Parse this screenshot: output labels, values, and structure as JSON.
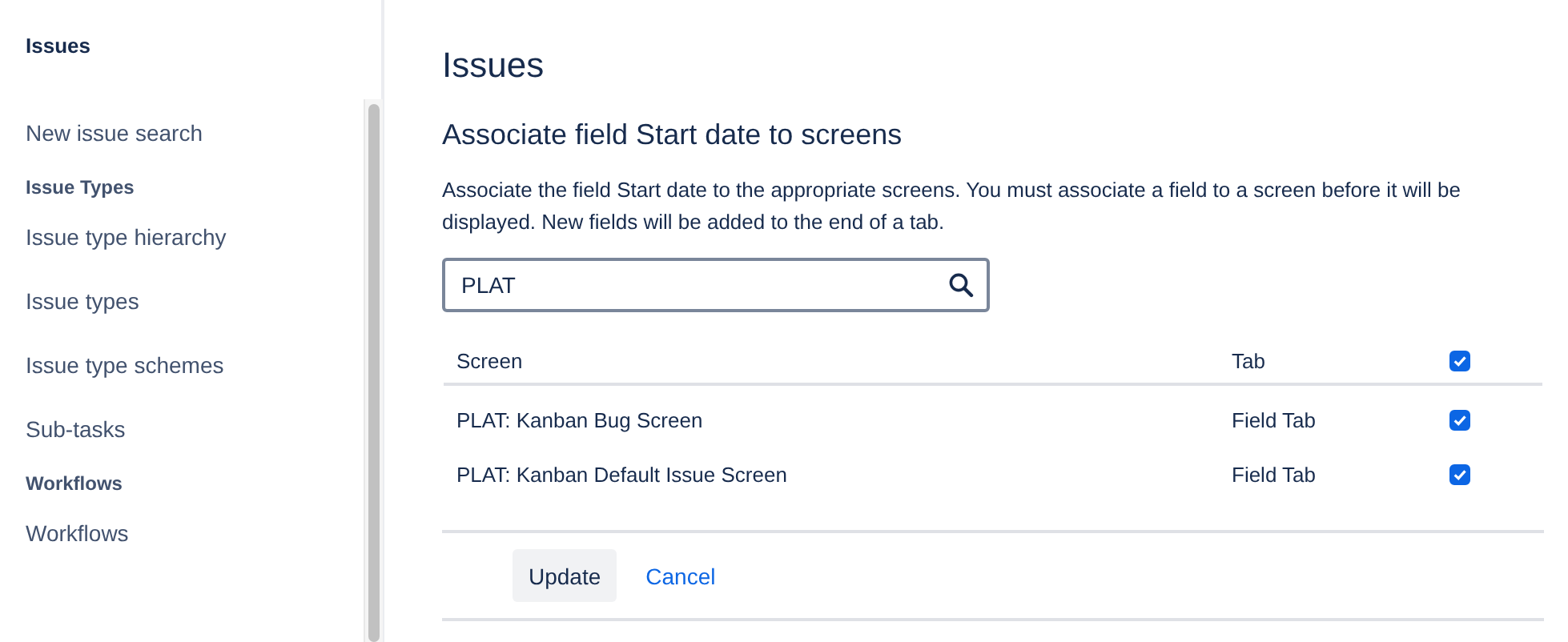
{
  "sidebar": {
    "title": "Issues",
    "items": [
      {
        "kind": "link",
        "label": "New issue search"
      },
      {
        "kind": "heading",
        "label": "Issue Types"
      },
      {
        "kind": "link",
        "label": "Issue type hierarchy"
      },
      {
        "kind": "link",
        "label": "Issue types"
      },
      {
        "kind": "link",
        "label": "Issue type schemes"
      },
      {
        "kind": "link",
        "label": "Sub-tasks"
      },
      {
        "kind": "heading",
        "label": "Workflows"
      },
      {
        "kind": "link",
        "label": "Workflows"
      }
    ]
  },
  "page_title": "Issues",
  "heading": "Associate field Start date to screens",
  "description": "Associate the field Start date to the appropriate screens. You must associate a field to a screen before it will be displayed. New fields will be added to the end of a tab.",
  "search": {
    "value": "PLAT"
  },
  "table": {
    "columns": [
      "Screen",
      "Tab"
    ],
    "select_all": {
      "checked": true
    },
    "rows": [
      {
        "screen": "PLAT: Kanban Bug Screen",
        "tab": "Field Tab",
        "checked": true
      },
      {
        "screen": "PLAT: Kanban Default Issue Screen",
        "tab": "Field Tab",
        "checked": true
      }
    ]
  },
  "buttons": [
    {
      "kind": "primary",
      "label": "Update"
    },
    {
      "kind": "link",
      "label": "Cancel"
    }
  ]
}
